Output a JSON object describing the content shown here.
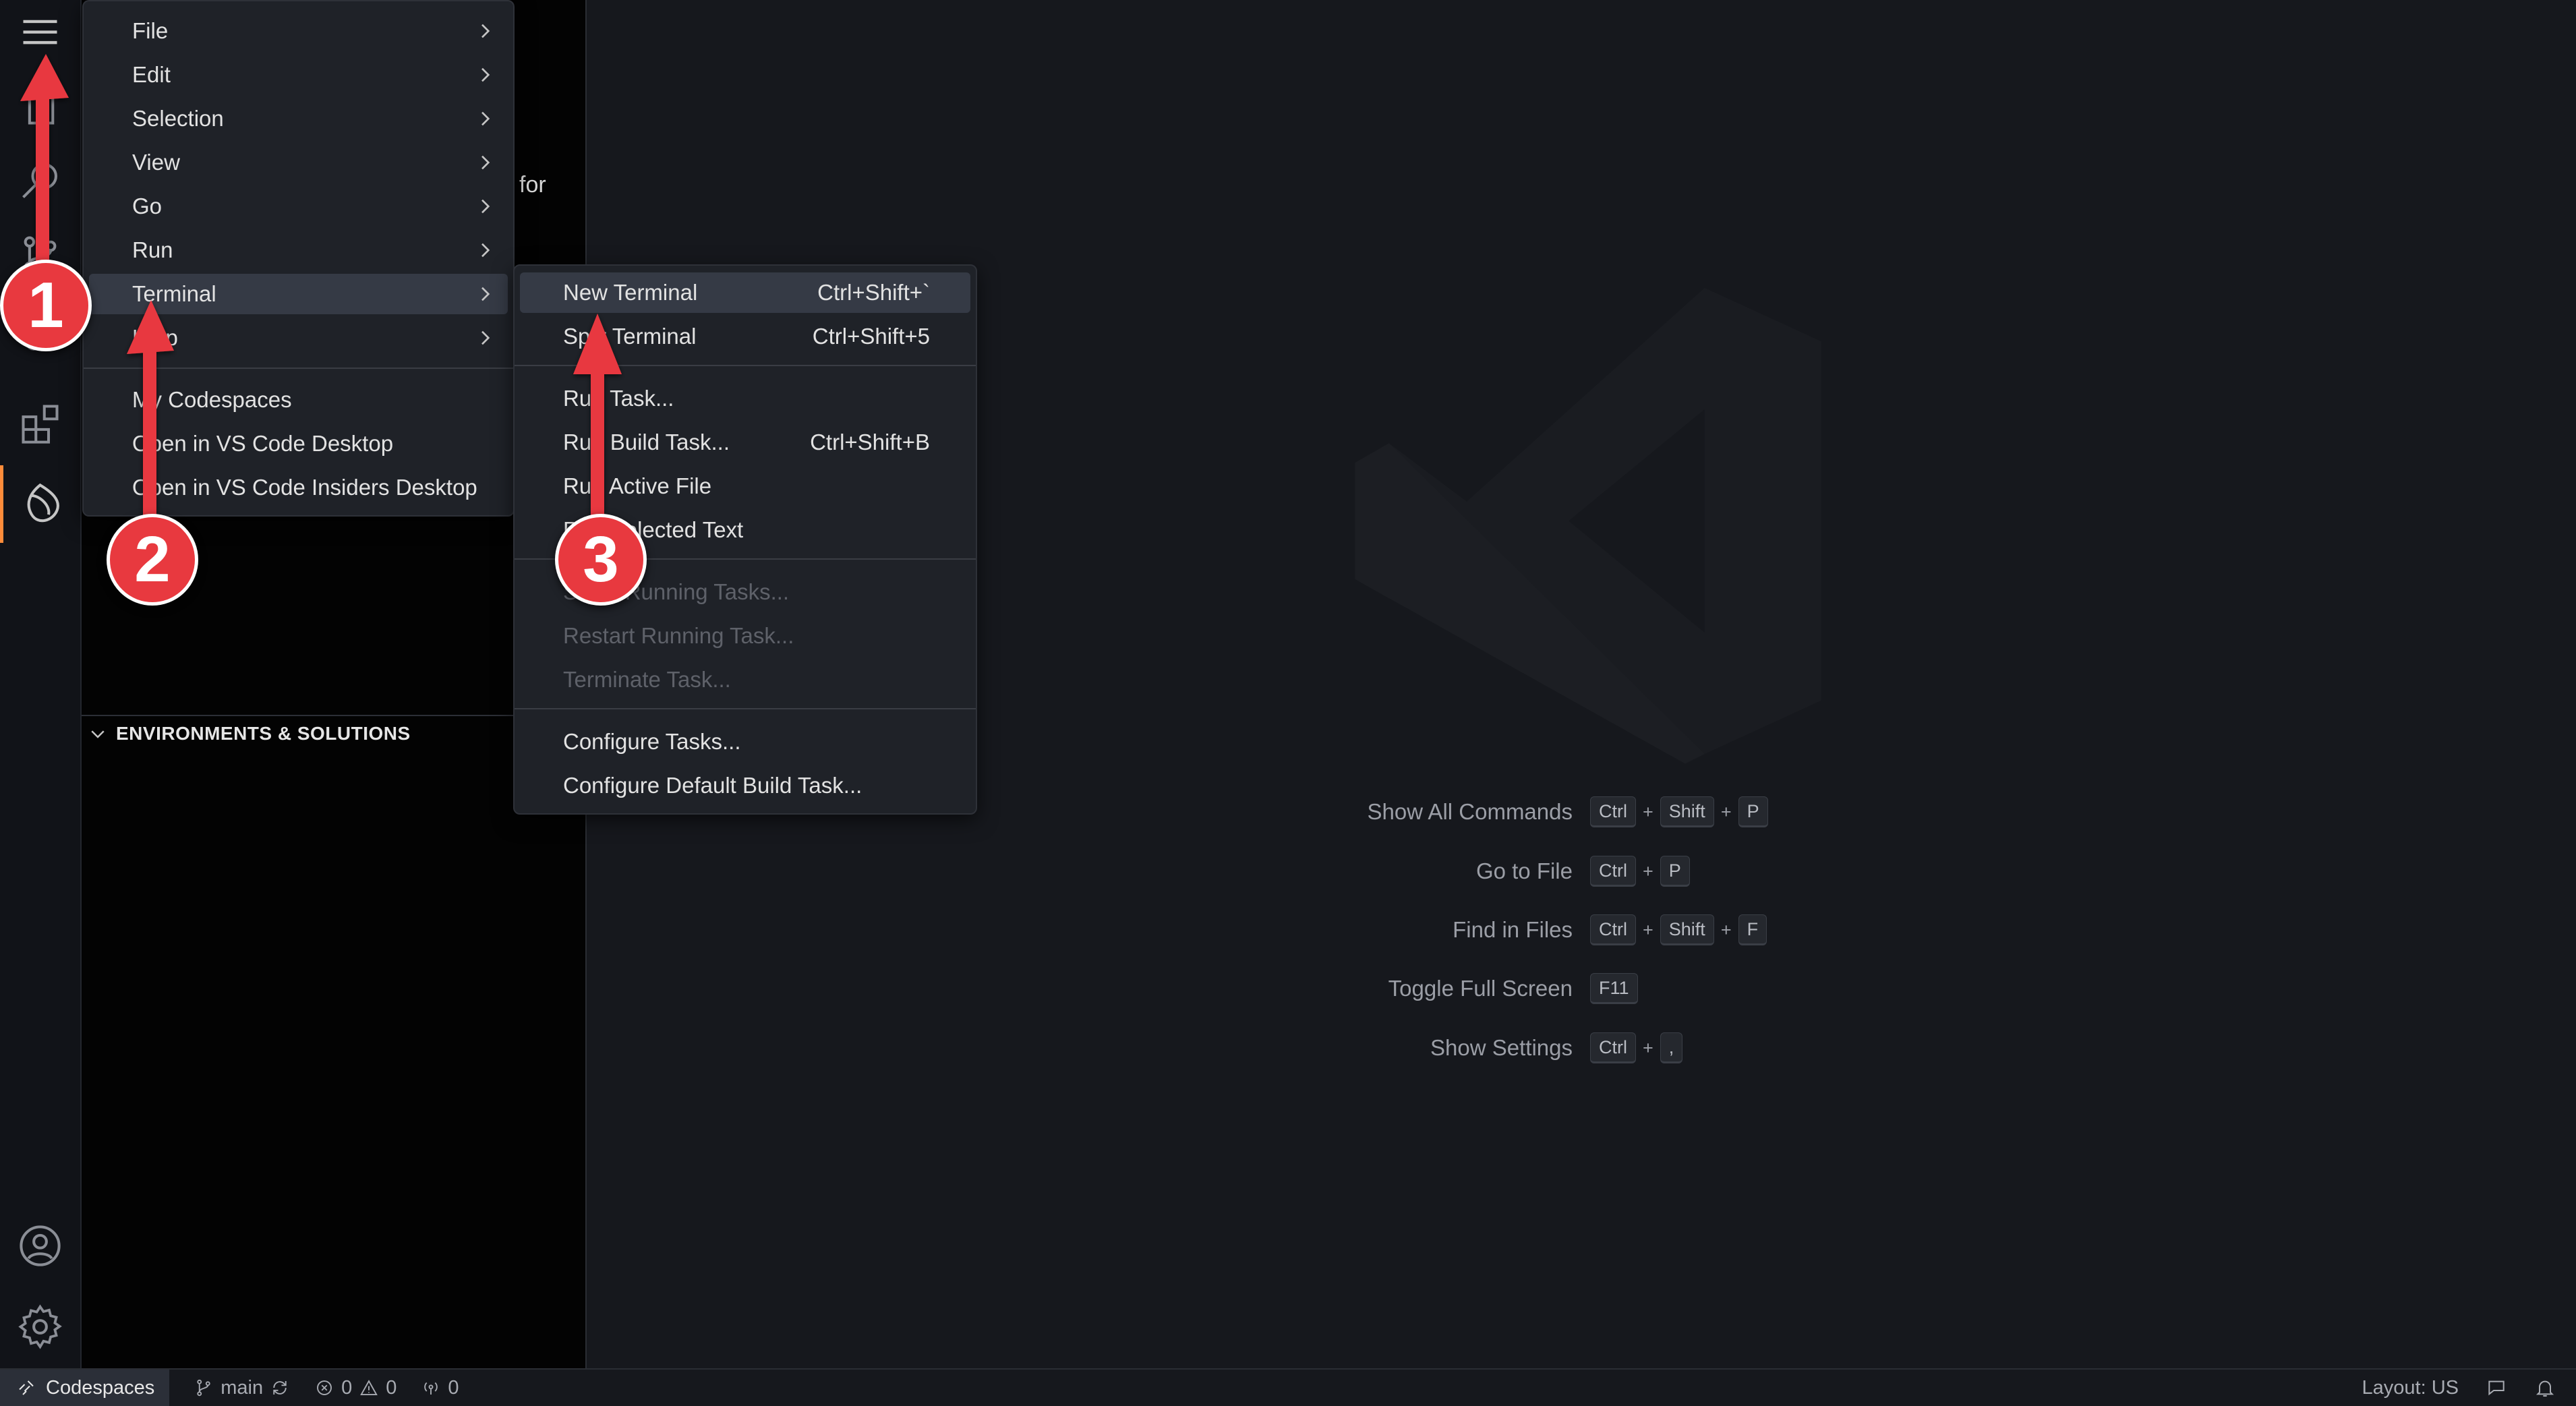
{
  "sidebar": {
    "partial_text": "for",
    "section_header": "ENVIRONMENTS & SOLUTIONS"
  },
  "main_menu": {
    "items": [
      {
        "label": "File",
        "submenu": true
      },
      {
        "label": "Edit",
        "submenu": true
      },
      {
        "label": "Selection",
        "submenu": true
      },
      {
        "label": "View",
        "submenu": true
      },
      {
        "label": "Go",
        "submenu": true
      },
      {
        "label": "Run",
        "submenu": true
      },
      {
        "label": "Terminal",
        "submenu": true,
        "selected": true
      },
      {
        "label": "Help",
        "submenu": true
      },
      {
        "label": "My Codespaces"
      },
      {
        "label": "Open in VS Code Desktop"
      },
      {
        "label": "Open in VS Code Insiders Desktop"
      }
    ]
  },
  "terminal_menu": {
    "items": [
      {
        "label": "New Terminal",
        "shortcut": "Ctrl+Shift+`",
        "selected": true
      },
      {
        "label": "Split Terminal",
        "shortcut": "Ctrl+Shift+5"
      },
      {
        "label": "Run Task..."
      },
      {
        "label": "Run Build Task...",
        "shortcut": "Ctrl+Shift+B"
      },
      {
        "label": "Run Active File"
      },
      {
        "label": "Run Selected Text"
      },
      {
        "label": "Show Running Tasks...",
        "disabled": true
      },
      {
        "label": "Restart Running Task...",
        "disabled": true
      },
      {
        "label": "Terminate Task...",
        "disabled": true
      },
      {
        "label": "Configure Tasks..."
      },
      {
        "label": "Configure Default Build Task..."
      }
    ]
  },
  "editor": {
    "commands": [
      {
        "label": "Show All Commands",
        "keys": [
          "Ctrl",
          "Shift",
          "P"
        ]
      },
      {
        "label": "Go to File",
        "keys": [
          "Ctrl",
          "P"
        ]
      },
      {
        "label": "Find in Files",
        "keys": [
          "Ctrl",
          "Shift",
          "F"
        ]
      },
      {
        "label": "Toggle Full Screen",
        "keys": [
          "F11"
        ]
      },
      {
        "label": "Show Settings",
        "keys": [
          "Ctrl",
          ","
        ]
      }
    ],
    "plus": "+"
  },
  "status_bar": {
    "remote": "Codespaces",
    "branch": "main",
    "errors": "0",
    "warnings": "0",
    "ports": "0",
    "layout": "Layout: US"
  },
  "annotations": {
    "step1": "1",
    "step2": "2",
    "step3": "3"
  },
  "colors": {
    "accent": "#ff8c3a",
    "annotation": "#e8393f",
    "menu_bg": "#1f2228",
    "menu_selected": "#353a45"
  }
}
